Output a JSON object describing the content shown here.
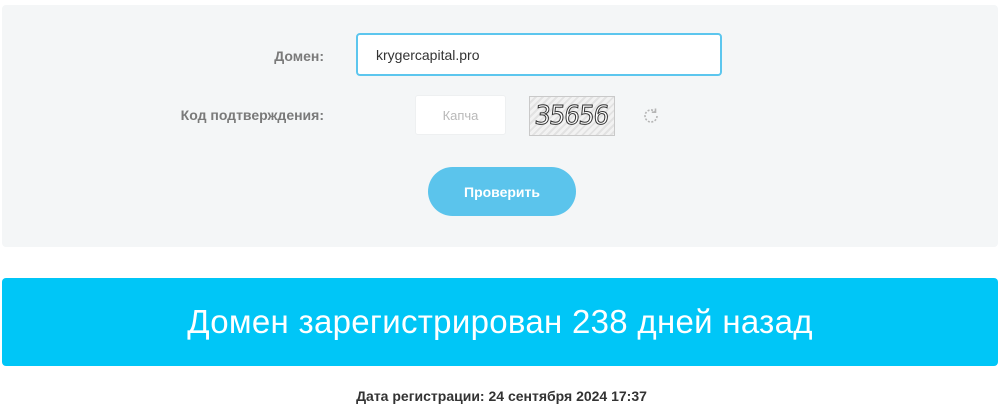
{
  "form": {
    "domain_label": "Домен:",
    "domain_value": "krygercapital.pro",
    "code_label": "Код подтверждения:",
    "captcha_placeholder": "Капча",
    "captcha_text": "35656",
    "check_button_label": "Проверить"
  },
  "result": {
    "banner_text": "Домен зарегистрирован 238 дней назад",
    "registration_date": "Дата регистрации: 24 сентября 2024 17:37"
  },
  "icons": {
    "refresh": "refresh-icon"
  },
  "colors": {
    "input_border": "#5cc6ee",
    "button_bg": "#5bc4ec",
    "banner_bg": "#00c6f7",
    "panel_bg": "#f4f6f7"
  }
}
